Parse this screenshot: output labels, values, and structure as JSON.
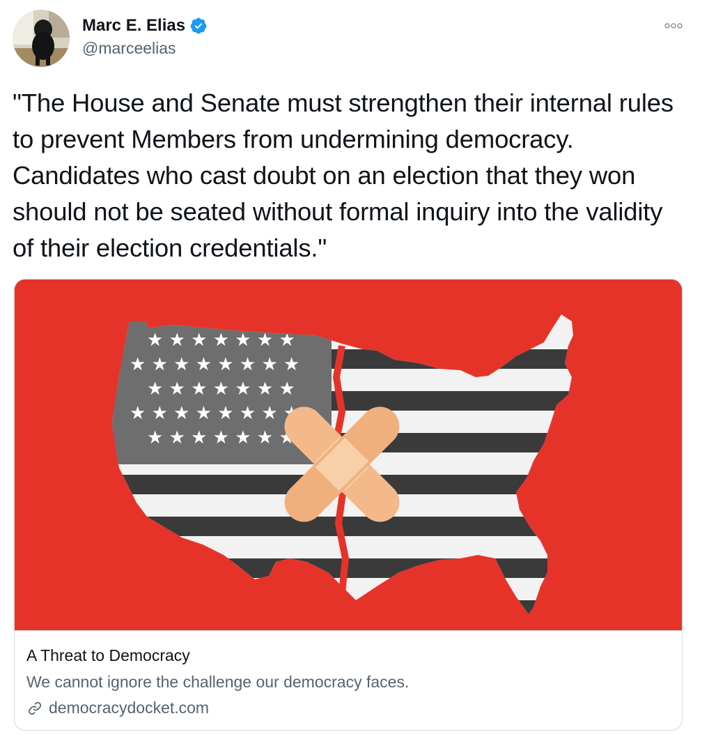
{
  "tweet": {
    "author": {
      "name": "Marc E. Elias",
      "handle": "@marceelias",
      "verified": true,
      "verified_color": "#1d9bf0"
    },
    "text": "\"The House and Senate must strengthen their internal rules to prevent Members from undermining democracy. Candidates who cast doubt on an election that they won should not be seated without formal inquiry into the validity of their election credentials.\"",
    "more_icon": "more-options-icon"
  },
  "card": {
    "image_description_icon": "patched-us-flag-map-image",
    "image_bg_color": "#e6332a",
    "title": "A Threat to Democracy",
    "description": "We cannot ignore the challenge our democracy faces.",
    "domain": "democracydocket.com",
    "link_icon": "link-icon"
  }
}
